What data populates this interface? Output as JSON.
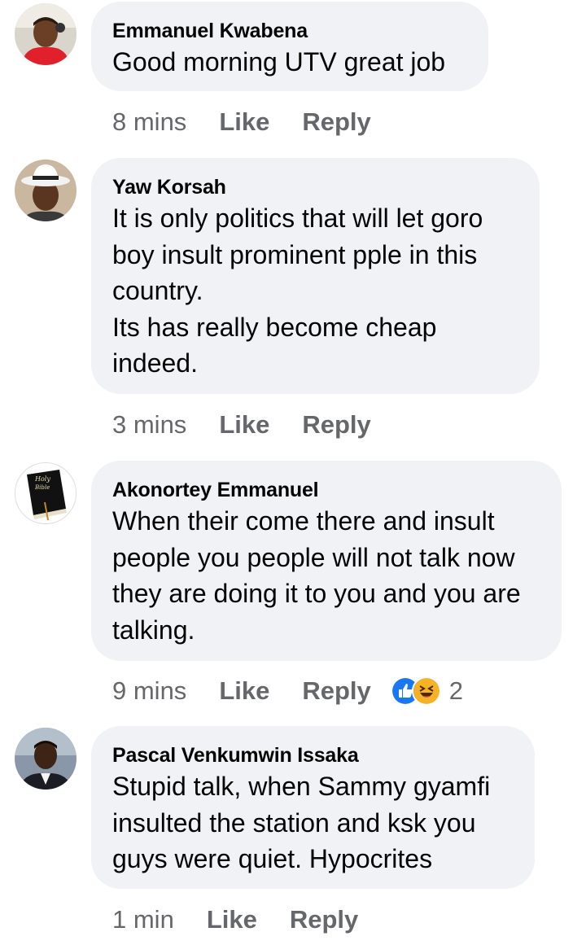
{
  "comments": [
    {
      "author": "Emmanuel Kwabena",
      "text": "Good morning UTV great job",
      "time": "8 mins",
      "like_label": "Like",
      "reply_label": "Reply",
      "avatar": "avatar-photo-red-shirt"
    },
    {
      "author": "Yaw Korsah",
      "text": "It is only politics that will let  goro\nboy insult  prominent pple in this\ncountry.\nIts has really become cheap\nindeed.",
      "time": "3 mins",
      "like_label": "Like",
      "reply_label": "Reply",
      "avatar": "avatar-photo-white-hat"
    },
    {
      "author": "Akonortey Emmanuel",
      "text": "When their come there and insult\npeople you people will not talk now\nthey are doing it to you and you are\ntalking.",
      "time": "9 mins",
      "like_label": "Like",
      "reply_label": "Reply",
      "avatar": "avatar-holy-bible",
      "avatar_text_1": "Holy",
      "avatar_text_2": "Bible",
      "reactions": {
        "icons": [
          "like-reaction-icon",
          "haha-reaction-icon"
        ],
        "count": "2",
        "like_color": "#1877f2",
        "haha_color": "#f7b125"
      }
    },
    {
      "author": "Pascal Venkumwin Issaka",
      "text": "Stupid talk, when Sammy gyamfi\ninsulted the station and ksk you\nguys were quiet. Hypocrites",
      "time": "1 min",
      "like_label": "Like",
      "reply_label": "Reply",
      "avatar": "avatar-photo-suit"
    }
  ],
  "colors": {
    "bubble": "#f0f2f5",
    "meta_text": "#65676b",
    "body_text": "#050505"
  }
}
